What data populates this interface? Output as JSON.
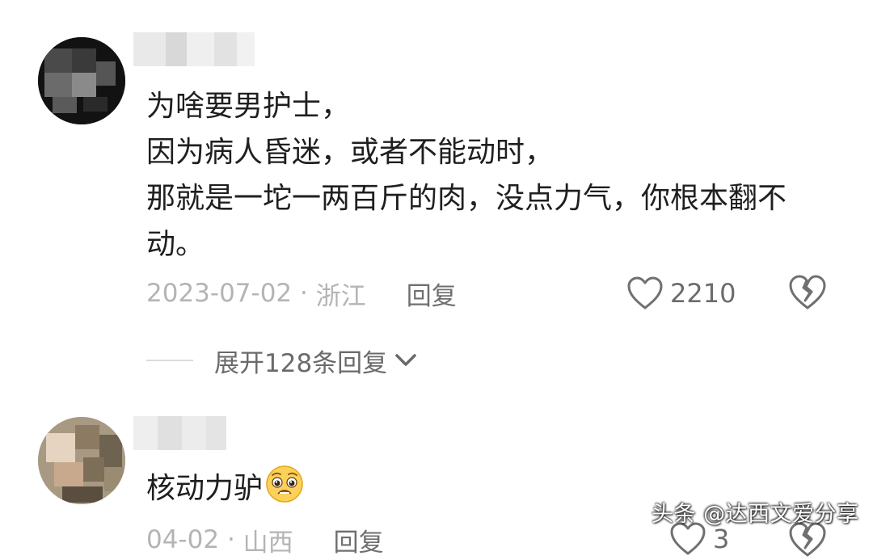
{
  "comments": [
    {
      "text_lines": [
        "为啥要男护士，",
        "因为病人昏迷，或者不能动时，",
        "那就是一坨一两百斤的肉，没点力气，你根本翻不",
        "动。"
      ],
      "date": "2023-07-02",
      "separator": " · ",
      "location": "浙江",
      "reply_label": "回复",
      "like_count": "2210",
      "expand_label": "展开128条回复"
    },
    {
      "text": "核动力驴",
      "emoji": "pleading-face-emoji",
      "date": "04-02",
      "separator": " · ",
      "location": "山西",
      "reply_label": "回复",
      "like_count": "3"
    }
  ],
  "watermark": "头条 @达西文爱分享",
  "colors": {
    "text": "#1f1f1f",
    "meta": "#b4b4b4",
    "action": "#6f6f6f",
    "icon": "#707070"
  },
  "icons": [
    "heart-outline-icon",
    "broken-heart-icon",
    "chevron-down-icon"
  ]
}
